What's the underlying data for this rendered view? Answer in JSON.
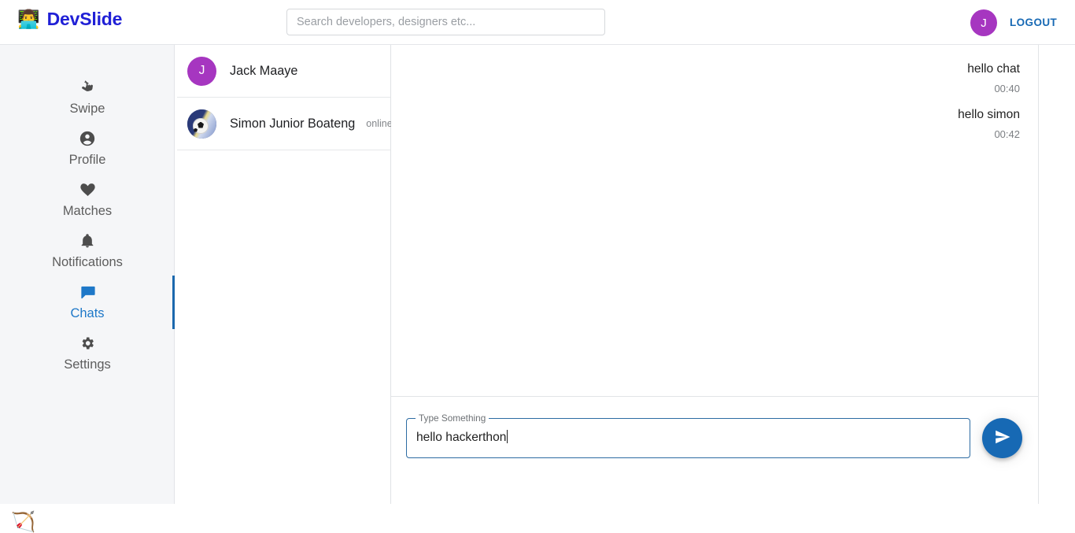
{
  "header": {
    "brand_logo_icon": "technologist-emoji",
    "brand_name": "DevSlide",
    "search_placeholder": "Search developers, designers etc...",
    "search_value": "",
    "avatar_initial": "J",
    "avatar_color": "#a636c0",
    "logout_label": "LOGOUT",
    "logout_color": "#1769b4"
  },
  "sidebar": {
    "background": "#f5f6f8",
    "active_indicator_color": "#1b68ad",
    "active_item_color": "#1e78c8",
    "items": [
      {
        "label": "Swipe",
        "icon": "swipe-hand-icon",
        "active": false
      },
      {
        "label": "Profile",
        "icon": "person-circle-icon",
        "active": false
      },
      {
        "label": "Matches",
        "icon": "heart-icon",
        "active": false
      },
      {
        "label": "Notifications",
        "icon": "bell-icon",
        "active": false
      },
      {
        "label": "Chats",
        "icon": "chat-bubble-icon",
        "active": true
      },
      {
        "label": "Settings",
        "icon": "gear-icon",
        "active": false
      }
    ],
    "footer_icon": "rosette-flower-icon"
  },
  "chat_list": {
    "items": [
      {
        "name": "Jack Maaye",
        "avatar_type": "letter",
        "avatar_initial": "J",
        "avatar_color": "#a636c0",
        "status": ""
      },
      {
        "name": "Simon Junior Boateng",
        "avatar_type": "photo",
        "avatar_initial": "",
        "avatar_color": "#21306e",
        "status": "online"
      }
    ]
  },
  "conversation": {
    "messages": [
      {
        "text": "hello chat",
        "time": "00:40",
        "align": "right"
      },
      {
        "text": "hello simon",
        "time": "00:42",
        "align": "right"
      }
    ]
  },
  "composer": {
    "label": "Type Something",
    "value": "hello hackerthon",
    "placeholder": "Type Something",
    "send_button_icon": "send-paper-plane-icon",
    "send_button_color": "#1769b4"
  }
}
